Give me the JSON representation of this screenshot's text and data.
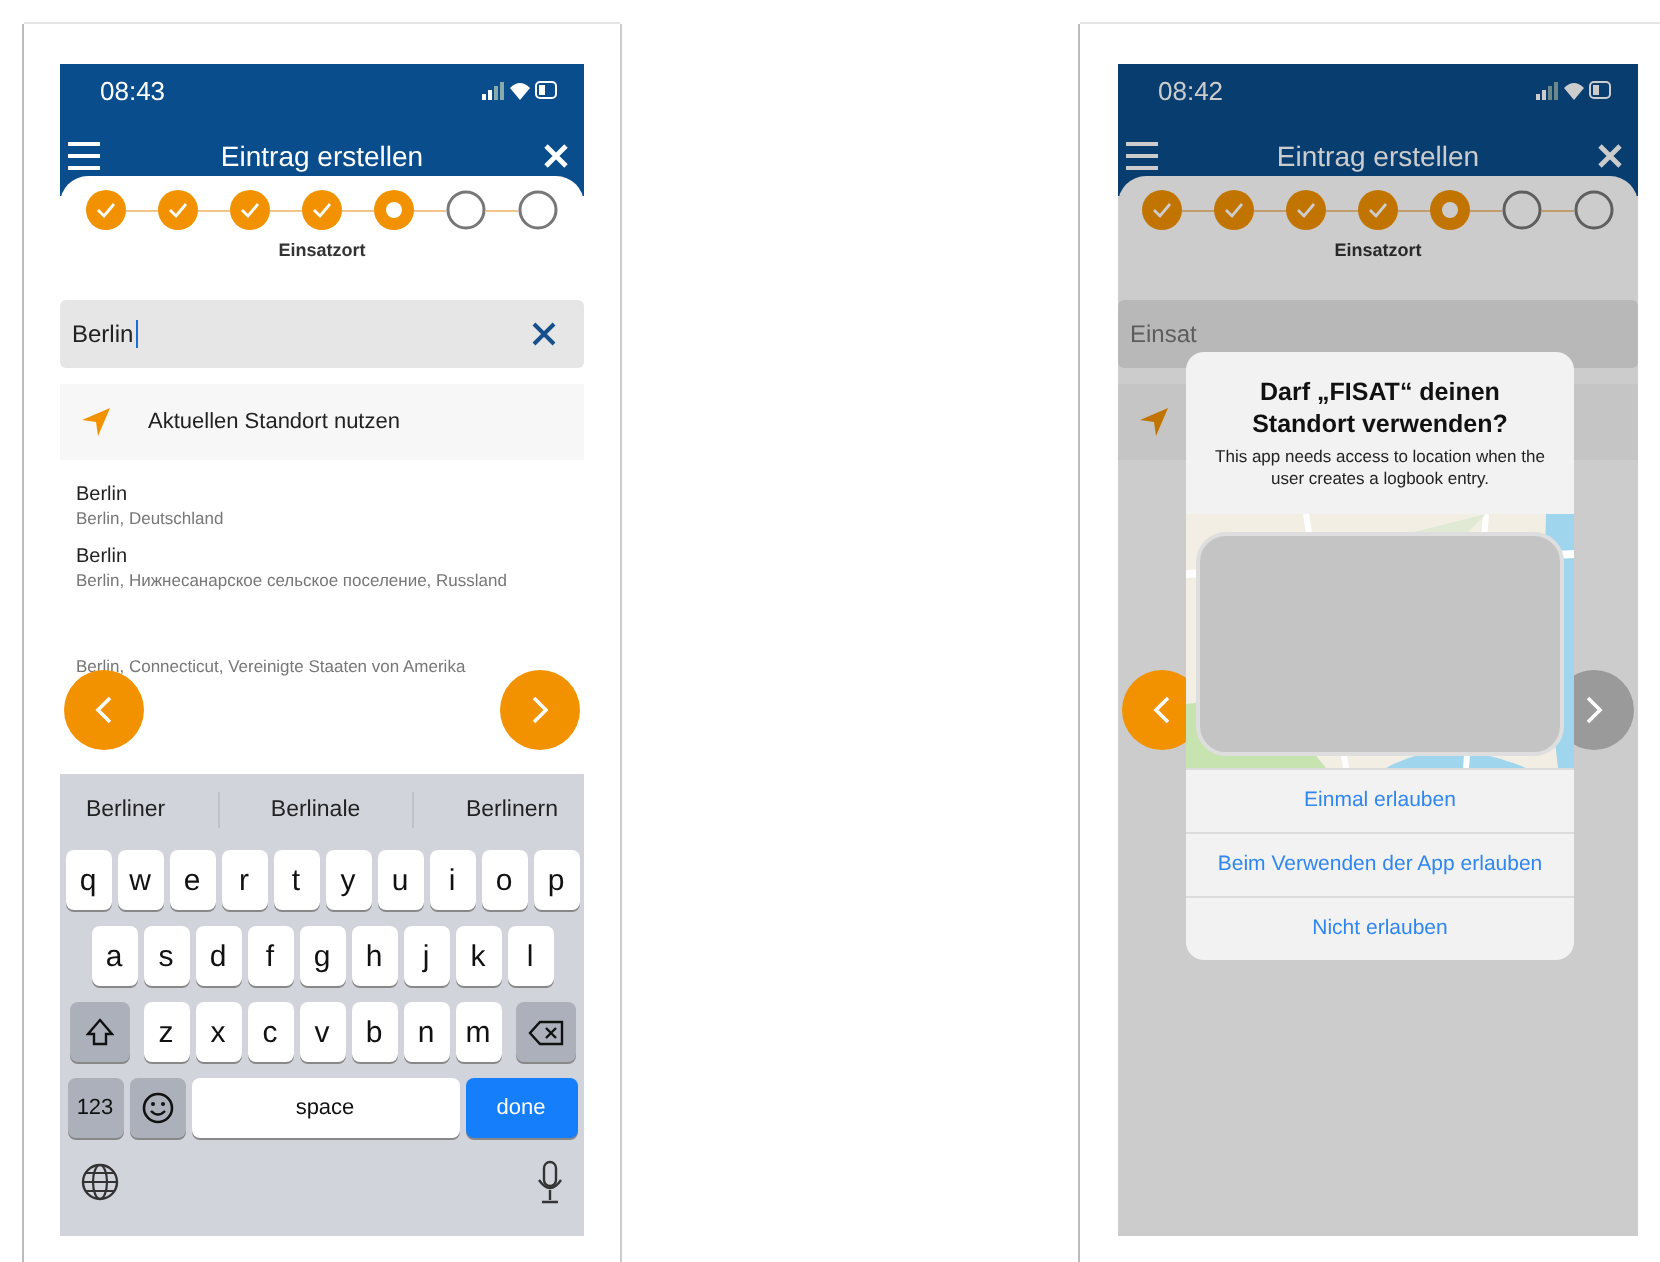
{
  "screens": [
    {
      "status_bar": {
        "time": "08:43"
      },
      "header": {
        "title": "Eintrag erstellen"
      },
      "steps": [
        {
          "kind": "done"
        },
        {
          "kind": "done"
        },
        {
          "kind": "done"
        },
        {
          "kind": "done"
        },
        {
          "kind": "current"
        },
        {
          "kind": "todo"
        },
        {
          "kind": "todo"
        }
      ],
      "step_label": "Einsatzort",
      "search": {
        "value": "Berlin",
        "focused": true
      },
      "location_row": {
        "label": "Aktuellen Standort nutzen"
      },
      "results": [
        {
          "title": "Berlin",
          "subtitle": "Berlin, Deutschland"
        },
        {
          "title": "Berlin",
          "subtitle": "Berlin, Нижнесанарское сельское поселение, Russland"
        },
        {
          "subtitle": "Berlin, Connecticut, Vereinigte Staaten von Amerika"
        }
      ],
      "nav": {
        "back_enabled": true,
        "next_enabled": true
      },
      "keyboard": {
        "suggestions": [
          "Berliner",
          "Berlinale",
          "Berlinern"
        ],
        "rows": [
          {
            "keys": [
              {
                "kind": "char",
                "label": "q"
              },
              {
                "kind": "char",
                "label": "w"
              },
              {
                "kind": "char",
                "label": "e"
              },
              {
                "kind": "char",
                "label": "r"
              },
              {
                "kind": "char",
                "label": "t"
              },
              {
                "kind": "char",
                "label": "y"
              },
              {
                "kind": "char",
                "label": "u"
              },
              {
                "kind": "char",
                "label": "i"
              },
              {
                "kind": "char",
                "label": "o"
              },
              {
                "kind": "char",
                "label": "p"
              }
            ]
          },
          {
            "keys": [
              {
                "kind": "char",
                "label": "a"
              },
              {
                "kind": "char",
                "label": "s"
              },
              {
                "kind": "char",
                "label": "d"
              },
              {
                "kind": "char",
                "label": "f"
              },
              {
                "kind": "char",
                "label": "g"
              },
              {
                "kind": "char",
                "label": "h"
              },
              {
                "kind": "char",
                "label": "j"
              },
              {
                "kind": "char",
                "label": "k"
              },
              {
                "kind": "char",
                "label": "l"
              }
            ]
          },
          {
            "keys": [
              {
                "kind": "shift"
              },
              {
                "kind": "char",
                "label": "z"
              },
              {
                "kind": "char",
                "label": "x"
              },
              {
                "kind": "char",
                "label": "c"
              },
              {
                "kind": "char",
                "label": "v"
              },
              {
                "kind": "char",
                "label": "b"
              },
              {
                "kind": "char",
                "label": "n"
              },
              {
                "kind": "char",
                "label": "m"
              },
              {
                "kind": "backspace"
              }
            ]
          },
          {
            "keys": [
              {
                "kind": "mode",
                "label": "123"
              },
              {
                "kind": "emoji"
              },
              {
                "kind": "space",
                "label": "space"
              },
              {
                "kind": "done",
                "label": "done"
              }
            ]
          }
        ]
      }
    },
    {
      "status_bar": {
        "time": "08:42"
      },
      "header": {
        "title": "Eintrag erstellen"
      },
      "steps": [
        {
          "kind": "done"
        },
        {
          "kind": "done"
        },
        {
          "kind": "done"
        },
        {
          "kind": "done"
        },
        {
          "kind": "current"
        },
        {
          "kind": "todo"
        },
        {
          "kind": "todo"
        }
      ],
      "step_label": "Einsatzort",
      "search": {
        "placeholder": "Einsat"
      },
      "dimmed": true,
      "dialog": {
        "title": "Darf „FISAT“ deinen Standort verwenden?",
        "message": "This app needs access to location when the user creates a logbook entry.",
        "buttons": [
          "Einmal erlauben",
          "Beim Verwenden der App erlauben",
          "Nicht erlauben"
        ]
      },
      "nav": {
        "back_enabled": true,
        "next_enabled": false
      }
    }
  ]
}
